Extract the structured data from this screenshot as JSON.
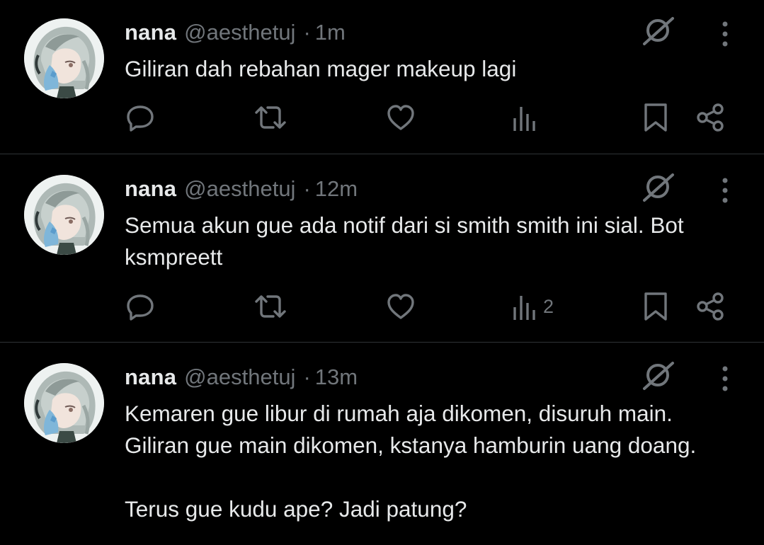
{
  "colors": {
    "background": "#000000",
    "text_primary": "#e7e9ea",
    "text_secondary": "#71767b",
    "divider": "#2f3336"
  },
  "icons": {
    "reply": "reply-icon",
    "retweet": "retweet-icon",
    "like": "heart-icon",
    "views": "analytics-icon",
    "bookmark": "bookmark-icon",
    "share": "share-icon",
    "grok": "grok-icon",
    "more": "more-dots-icon"
  },
  "tweets": [
    {
      "author_name": "nana",
      "author_handle": "@aesthetuj",
      "separator": "·",
      "time": "1m",
      "text": "Giliran dah rebahan mager makeup lagi",
      "views_count": ""
    },
    {
      "author_name": "nana",
      "author_handle": "@aesthetuj",
      "separator": "·",
      "time": "12m",
      "text": "Semua akun gue ada notif dari si smith smith ini sial. Bot\nksmpreett",
      "views_count": "2"
    },
    {
      "author_name": "nana",
      "author_handle": "@aesthetuj",
      "separator": "·",
      "time": "13m",
      "text": "Kemaren gue libur di rumah aja dikomen, disuruh main.\nGiliran gue main dikomen, kstanya hamburin uang doang.\n\nTerus gue kudu ape? Jadi patung?",
      "views_count": ""
    }
  ]
}
